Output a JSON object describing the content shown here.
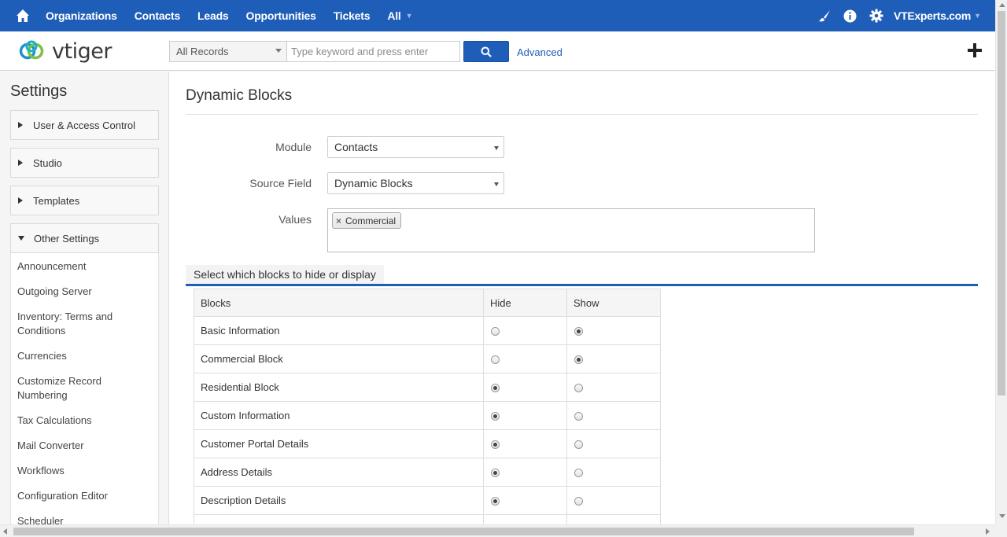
{
  "topnav": {
    "links": [
      "Organizations",
      "Contacts",
      "Leads",
      "Opportunities",
      "Tickets",
      "All"
    ],
    "user": "VTExperts.com",
    "icons": [
      "home-icon",
      "brush-icon",
      "info-icon",
      "gear-icon"
    ],
    "bg_color": "#1f5eb8"
  },
  "header": {
    "logo_text": "vtiger",
    "record_filter": "All Records",
    "search_placeholder": "Type keyword and press enter",
    "advanced_label": "Advanced"
  },
  "sidebar": {
    "title": "Settings",
    "sections": [
      {
        "label": "User & Access Control",
        "expanded": false
      },
      {
        "label": "Studio",
        "expanded": false
      },
      {
        "label": "Templates",
        "expanded": false
      },
      {
        "label": "Other Settings",
        "expanded": true
      }
    ],
    "items": [
      "Announcement",
      "Outgoing Server",
      "Inventory: Terms and Conditions",
      "Currencies",
      "Customize Record Numbering",
      "Tax Calculations",
      "Mail Converter",
      "Workflows",
      "Configuration Editor",
      "Scheduler"
    ]
  },
  "main": {
    "title": "Dynamic Blocks",
    "module_label": "Module",
    "module_value": "Contacts",
    "source_field_label": "Source Field",
    "source_field_value": "Dynamic Blocks",
    "values_label": "Values",
    "values_tags": [
      "Commercial"
    ],
    "section_title": "Select which blocks to hide or display",
    "table": {
      "headers": [
        "Blocks",
        "Hide",
        "Show"
      ],
      "rows": [
        {
          "name": "Basic Information",
          "selected": "show"
        },
        {
          "name": "Commercial Block",
          "selected": "show"
        },
        {
          "name": "Residential Block",
          "selected": "hide"
        },
        {
          "name": "Custom Information",
          "selected": "hide"
        },
        {
          "name": "Customer Portal Details",
          "selected": "hide"
        },
        {
          "name": "Address Details",
          "selected": "hide"
        },
        {
          "name": "Description Details",
          "selected": "hide"
        },
        {
          "name": "",
          "selected": ""
        }
      ]
    }
  }
}
